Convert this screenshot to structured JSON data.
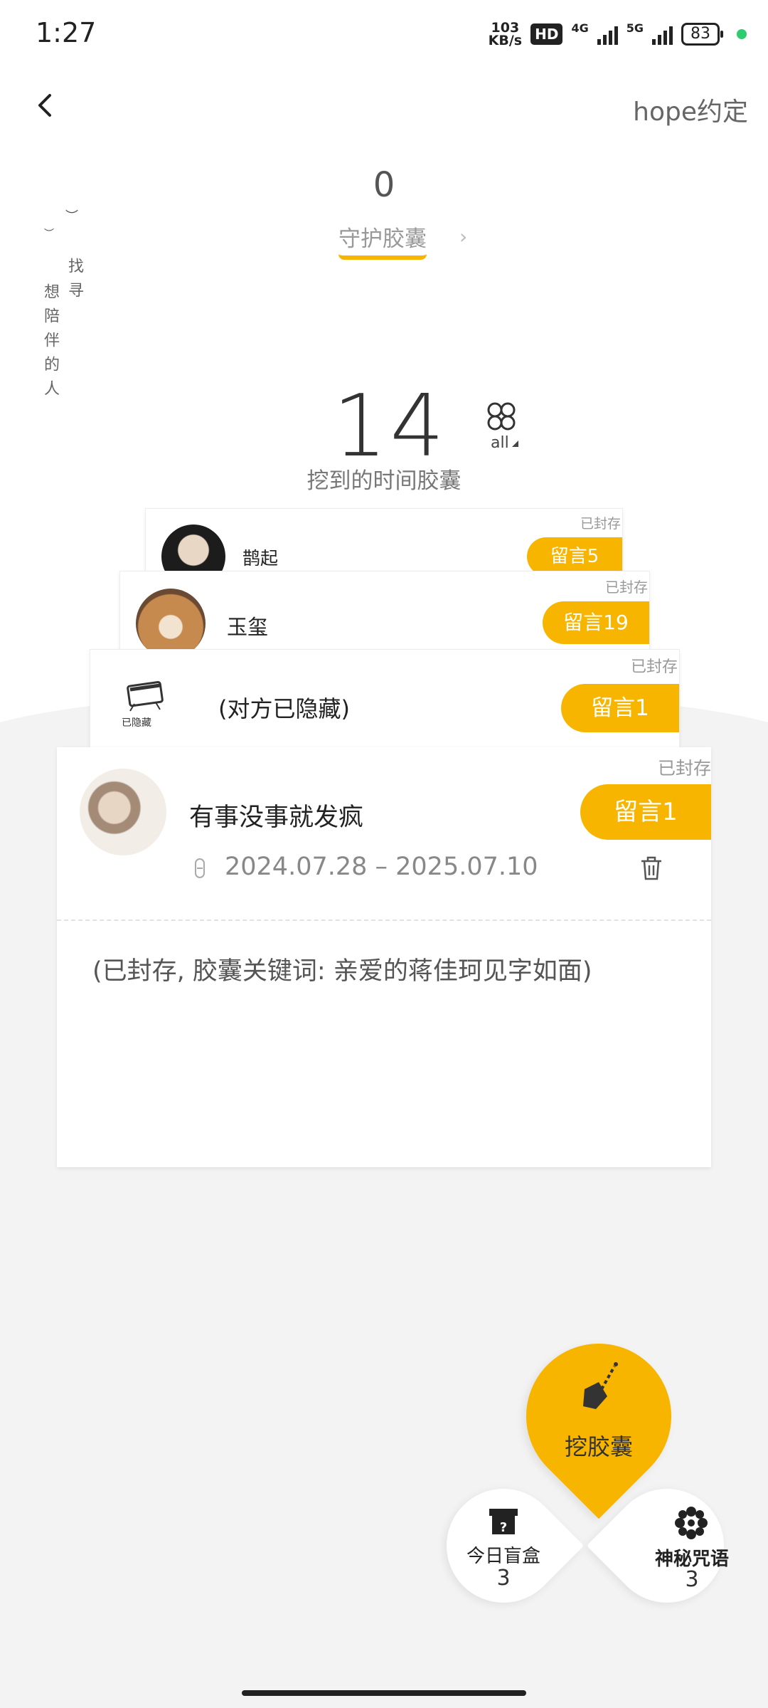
{
  "status_bar": {
    "time": "1:27",
    "net_speed_value": "103",
    "net_speed_unit": "KB/s",
    "hd": "HD",
    "net1": "4G",
    "net2": "5G",
    "battery": "83"
  },
  "header": {
    "right_link": "hope约定"
  },
  "guard": {
    "count": "0",
    "label": "守护胶囊"
  },
  "poem": {
    "col1": "找寻",
    "col2": "想陪伴的人"
  },
  "dug": {
    "count": "14",
    "label": "挖到的时间胶囊",
    "filter": "all"
  },
  "cards": [
    {
      "sealed": "已封存",
      "name": "鹊起",
      "message": "留言5"
    },
    {
      "sealed": "已封存",
      "name": "玉玺",
      "message": "留言19"
    },
    {
      "sealed": "已封存",
      "name": "(对方已隐藏)",
      "message": "留言1",
      "avatar_text": "已隐藏"
    }
  ],
  "main_card": {
    "sealed": "已封存",
    "name": "有事没事就发疯",
    "message": "留言1",
    "dates": "2024.07.28 – 2025.07.10",
    "keywords": "(已封存, 胶囊关键词: 亲爱的蒋佳珂见字如面)"
  },
  "actions": {
    "dig": "挖胶囊",
    "blind_box": {
      "label": "今日盲盒",
      "count": "3"
    },
    "spell": {
      "label": "神秘咒语",
      "count": "3"
    }
  },
  "colors": {
    "accent": "#f7b500"
  }
}
